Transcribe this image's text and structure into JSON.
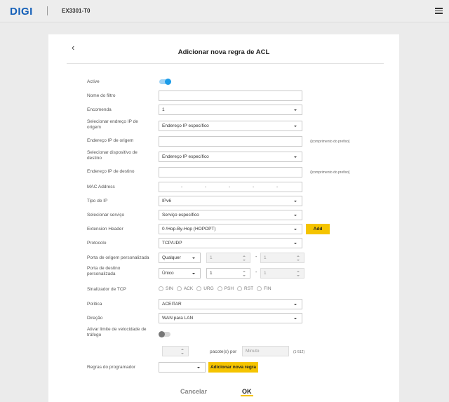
{
  "header": {
    "logo": "DIGI",
    "model": "EX3301-T0"
  },
  "page": {
    "title": "Adicionar nova regra de ACL",
    "back_symbol": "‹"
  },
  "form": {
    "active": {
      "label": "Active",
      "on": true
    },
    "filter_name": {
      "label": "Nome do filtro",
      "value": ""
    },
    "order": {
      "label": "Encomenda",
      "value": "1"
    },
    "src_ip_type": {
      "label": "Selecionar endreço IP de origem",
      "value": "Endereço IP específico"
    },
    "src_ip": {
      "label": "Endereço IP de origem",
      "value": "",
      "hint": "/[comprimento do prefixo]"
    },
    "dst_device": {
      "label": "Selecionar dispositivo de destino",
      "value": "Endereço IP específico"
    },
    "dst_ip": {
      "label": "Endereço IP de destino",
      "value": "",
      "hint": "/[comprimento do prefixo]"
    },
    "mac": {
      "label": "MAC Address",
      "separator": "-"
    },
    "ip_type": {
      "label": "Tipo de IP",
      "value": "IPv6"
    },
    "service": {
      "label": "Selecionar serviço",
      "value": "Serviço específico"
    },
    "ext_header": {
      "label": "Extension Header",
      "value": "0 /Hop-By-Hop (HOPOPT)",
      "add_label": "Add"
    },
    "protocol": {
      "label": "Protocolo",
      "value": "TCP/UDP"
    },
    "src_port": {
      "label": "Porta de origem personalizada",
      "mode": "Qualquer",
      "from": "1",
      "to": "1",
      "dash": "-"
    },
    "dst_port": {
      "label": "Porta de destino personalizada",
      "mode": "Único",
      "from": "1",
      "to": "1",
      "dash": "-"
    },
    "tcp_flags": {
      "label": "Sinalizador de TCP",
      "options": [
        "SIN",
        "ACK",
        "URG",
        "PSH",
        "RST",
        "FIN"
      ]
    },
    "policy": {
      "label": "Política",
      "value": "ACEITAR"
    },
    "direction": {
      "label": "Direção",
      "value": "WAN para LAN"
    },
    "rate_limit": {
      "label": "Ativar limite de velocidade de tráfego",
      "on": false,
      "packets_label": "pacote(s) por",
      "unit": "Minuto",
      "range": "(1-512)"
    },
    "scheduler": {
      "label": "Regras do programador",
      "value": "",
      "add_label": "Adicionar nova regra"
    }
  },
  "footer": {
    "cancel": "Cancelar",
    "ok": "OK"
  },
  "colors": {
    "brand": "#1560b8",
    "toggle_on": "#1a9be8",
    "accent": "#f5c400"
  }
}
